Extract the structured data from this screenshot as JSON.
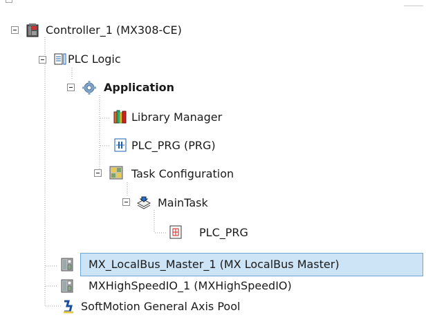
{
  "tree": {
    "controller": {
      "label": "Controller_1 (MX308-CE)",
      "icon": "controller-icon"
    },
    "plc_logic": {
      "label": "PLC Logic",
      "icon": "plc-logic-icon"
    },
    "application": {
      "label": "Application",
      "icon": "gear-icon"
    },
    "library_manager": {
      "label": "Library Manager",
      "icon": "library-books-icon"
    },
    "plc_prg_program": {
      "label": "PLC_PRG (PRG)",
      "icon": "program-icon"
    },
    "task_configuration": {
      "label": "Task Configuration",
      "icon": "task-config-icon"
    },
    "main_task": {
      "label": "MainTask",
      "icon": "task-stack-icon"
    },
    "plc_prg_call": {
      "label": "PLC_PRG",
      "icon": "program-call-icon"
    },
    "localbus_master": {
      "label": "MX_LocalBus_Master_1 (MX LocalBus Master)",
      "icon": "device-module-icon",
      "selected": true
    },
    "highspeed_io": {
      "label": "MXHighSpeedIO_1 (MXHighSpeedIO)",
      "icon": "device-module-icon"
    },
    "axis_pool": {
      "label": "SoftMotion General Axis Pool",
      "icon": "axis-pool-icon"
    }
  },
  "colors": {
    "selection_fill": "#cde3f6",
    "selection_border": "#6ea6d8"
  }
}
